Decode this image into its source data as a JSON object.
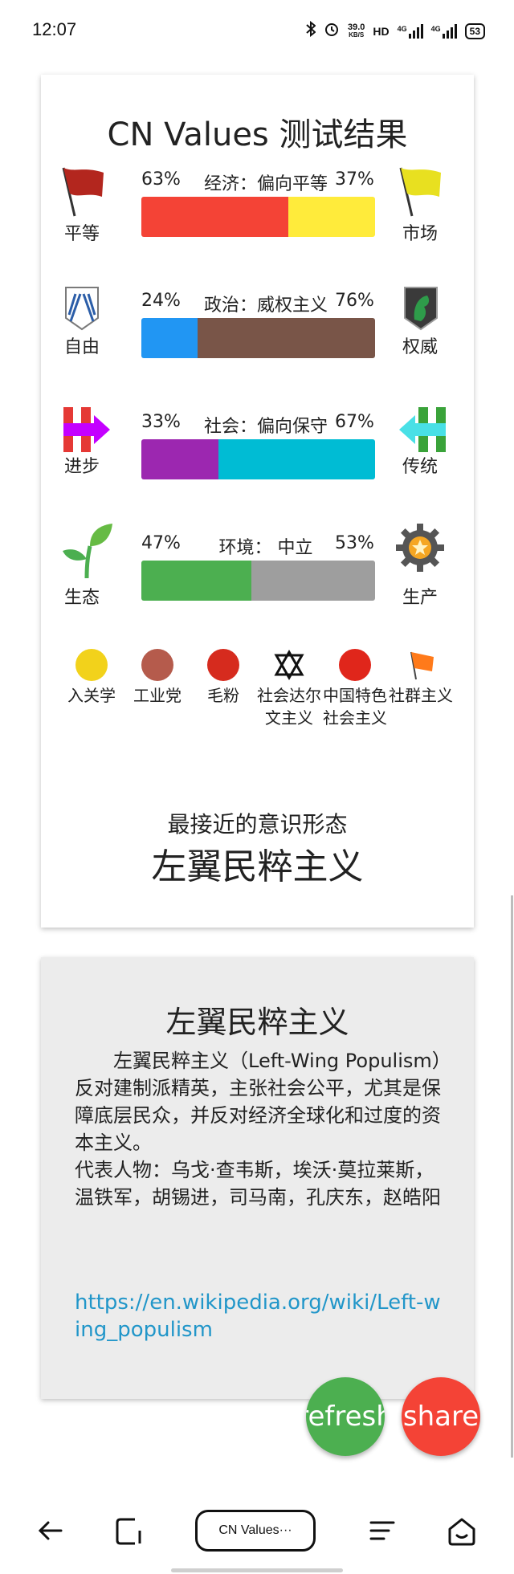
{
  "status_bar": {
    "time": "12:07",
    "speed_value": "39.0",
    "speed_unit": "KB/S",
    "hd_label": "HD",
    "net1": "4G",
    "net2": "4G",
    "battery": "53"
  },
  "result": {
    "title": "CN Values 测试结果",
    "axes": [
      {
        "left_label": "平等",
        "right_label": "市场",
        "left_pct": "63%",
        "right_pct": "37%",
        "axis_text": "经济：偏向平等",
        "left_value": 63,
        "left_color": "#f44336",
        "right_color": "#ffeb3b",
        "left_icon": "red-flag-icon",
        "right_icon": "yellow-flag-icon"
      },
      {
        "left_label": "自由",
        "right_label": "权威",
        "left_pct": "24%",
        "right_pct": "76%",
        "axis_text": "政治：威权主义",
        "left_value": 24,
        "left_color": "#2196f3",
        "right_color": "#795548",
        "left_icon": "wings-emblem-icon",
        "right_icon": "horse-emblem-icon"
      },
      {
        "left_label": "进步",
        "right_label": "传统",
        "left_pct": "33%",
        "right_pct": "67%",
        "axis_text": "社会：偏向保守",
        "left_value": 33,
        "left_color": "#9c27b0",
        "right_color": "#00bcd4",
        "left_icon": "progress-arrow-icon",
        "right_icon": "tradition-arrow-icon"
      },
      {
        "left_label": "生态",
        "right_label": "生产",
        "left_pct": "47%",
        "right_pct": "53%",
        "axis_text": "环境：  中立",
        "left_value": 47,
        "left_color": "#4caf50",
        "right_color": "#9e9e9e",
        "left_icon": "sprout-icon",
        "right_icon": "gear-icon"
      }
    ],
    "ideologies": [
      {
        "name": "入关学",
        "icon": "ruguanxue-icon",
        "color": "#f2d21b"
      },
      {
        "name": "工业党",
        "icon": "industry-party-icon",
        "color": "#b55b4c"
      },
      {
        "name": "毛粉",
        "icon": "mao-fan-icon",
        "color": "#d62b1e"
      },
      {
        "name": "社会达尔文主义",
        "icon": "social-darwinism-icon",
        "color": "#ffffff"
      },
      {
        "name": "中国特色社会主义",
        "icon": "socialism-chinese-characteristics-icon",
        "color": "#e0261b"
      },
      {
        "name": "社群主义",
        "icon": "communitarianism-flag-icon",
        "color": "#ff7a1a"
      }
    ],
    "closest_label": "最接近的意识形态",
    "closest_value": "左翼民粹主义"
  },
  "description": {
    "title": "左翼民粹主义",
    "paragraph": "　　左翼民粹主义（Left-Wing Populism）反对建制派精英，主张社会公平，尤其是保障底层民众，并反对经济全球化和过度的资本主义。",
    "representatives": "代表人物：乌戈·查韦斯，埃沃·莫拉莱斯，温铁军，胡锡进，司马南，孔庆东，赵皓阳",
    "link": "https://en.wikipedia.org/wiki/Left-wing_populism"
  },
  "fab": {
    "refresh_label": "refresh",
    "share_label": "share"
  },
  "nav": {
    "tab_label": "CN Values···"
  }
}
